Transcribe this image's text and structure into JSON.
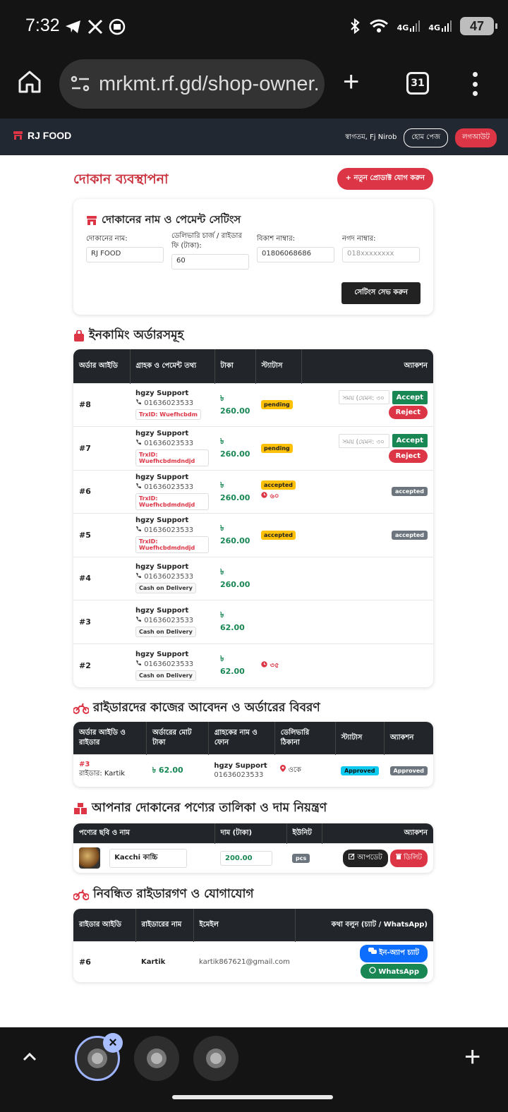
{
  "status": {
    "time": "7:32",
    "battery": "47"
  },
  "browser": {
    "url": "mrkmt.rf.gd/shop-owner.",
    "tab_count": "31"
  },
  "nav": {
    "brand": "RJ FOOD",
    "welcome": "স্বাগতম, Fj Nirob",
    "home_label": "হোম পেজ",
    "logout_label": "লগআউট"
  },
  "page": {
    "title": "দোকান ব্যবস্থাপনা",
    "new_product": "+ নতুন প্রোডাক্ট যোগ করুন"
  },
  "settings": {
    "title": "দোকানের নাম ও পেমেন্ট সেটিংস",
    "shop_name_label": "দোকানের নাম:",
    "shop_name_value": "RJ FOOD",
    "delivery_label": "ডেলিভারি চার্জ / রাইডার ফি (টাকা):",
    "delivery_value": "60",
    "bkash_label": "বিকাশ নাম্বার:",
    "bkash_value": "01806068686",
    "nagad_label": "নগদ নাম্বার:",
    "nagad_placeholder": "018xxxxxxxx",
    "save_label": "সেটিংস সেভ করুন"
  },
  "orders": {
    "title": "ইনকামিং অর্ডারসমূহ",
    "headers": [
      "অর্ডার আইডি",
      "গ্রাহক ও পেমেন্ট তথ্য",
      "টাকা",
      "স্ট্যাটাস",
      "অ্যাকশন"
    ],
    "time_placeholder": "সময় (যেমন: ৩০",
    "accept_label": "Accept",
    "reject_label": "Reject",
    "rows": [
      {
        "id": "#8",
        "name": "hgzy Support",
        "phone": "01636023533",
        "pay": "TrxID: Wuefhcbdm",
        "amount": "৳ 260.00",
        "status": "pending",
        "timer": "",
        "action": ""
      },
      {
        "id": "#7",
        "name": "hgzy Support",
        "phone": "01636023533",
        "pay": "TrxID: Wuefhcbdmdndjd",
        "amount": "৳ 260.00",
        "status": "pending",
        "timer": "",
        "action": ""
      },
      {
        "id": "#6",
        "name": "hgzy Support",
        "phone": "01636023533",
        "pay": "TrxID: Wuefhcbdmdndjd",
        "amount": "৳ 260.00",
        "status": "accepted",
        "timer": "৬০",
        "action": "accepted"
      },
      {
        "id": "#5",
        "name": "hgzy Support",
        "phone": "01636023533",
        "pay": "TrxID: Wuefhcbdmdndjd",
        "amount": "৳ 260.00",
        "status": "accepted",
        "timer": "",
        "action": "accepted"
      },
      {
        "id": "#4",
        "name": "hgzy Support",
        "phone": "01636023533",
        "pay": "Cash on Delivery",
        "amount": "৳ 260.00",
        "status": "",
        "timer": "",
        "action": ""
      },
      {
        "id": "#3",
        "name": "hgzy Support",
        "phone": "01636023533",
        "pay": "Cash on Delivery",
        "amount": "৳ 62.00",
        "status": "",
        "timer": "",
        "action": ""
      },
      {
        "id": "#2",
        "name": "hgzy Support",
        "phone": "01636023533",
        "pay": "Cash on Delivery",
        "amount": "৳ 62.00",
        "status": "",
        "timer": "৩৫",
        "action": ""
      }
    ]
  },
  "riders": {
    "title": "রাইডারদের কাজের আবেদন ও অর্ডারের বিবরণ",
    "headers": [
      "অর্ডার আইডি ও রাইডার",
      "অর্ডারের মোট টাকা",
      "গ্রাহকের নাম ও ফোন",
      "ডেলিভারি ঠিকানা",
      "স্ট্যাটাস",
      "অ্যাকশন"
    ],
    "row": {
      "order": "#3",
      "rider": "রাইডার: Kartik",
      "total": "৳ 62.00",
      "cname": "hgzy Support",
      "cphone": "01636023533",
      "address": "ওকে",
      "status": "Approved",
      "action": "Approved"
    }
  },
  "products": {
    "title": "আপনার দোকানের পণ্যের তালিকা ও দাম নিয়ন্ত্রণ",
    "headers": [
      "পণ্যের ছবি ও নাম",
      "দাম (টাকা)",
      "ইউনিট",
      "অ্যাকশন"
    ],
    "row": {
      "name": "Kacchi কাচ্চি",
      "price": "200.00",
      "unit": "pcs",
      "update": "আপডেট",
      "delete": "ডিলিট"
    }
  },
  "contacts": {
    "title": "নিবন্ধিত রাইডারগণ ও যোগাযোগ",
    "headers": [
      "রাইডার আইডি",
      "রাইডারের নাম",
      "ইমেইল",
      "কথা বলুন (চ্যাট / WhatsApp)"
    ],
    "row": {
      "id": "#6",
      "name": "Kartik",
      "email": "kartik867621@gmail.com",
      "chat": "ইন-অ্যাপ চ্যাট",
      "whatsapp": "WhatsApp"
    }
  },
  "colors": {
    "accent": "#dc3545",
    "success": "#198754",
    "dark": "#222831"
  }
}
